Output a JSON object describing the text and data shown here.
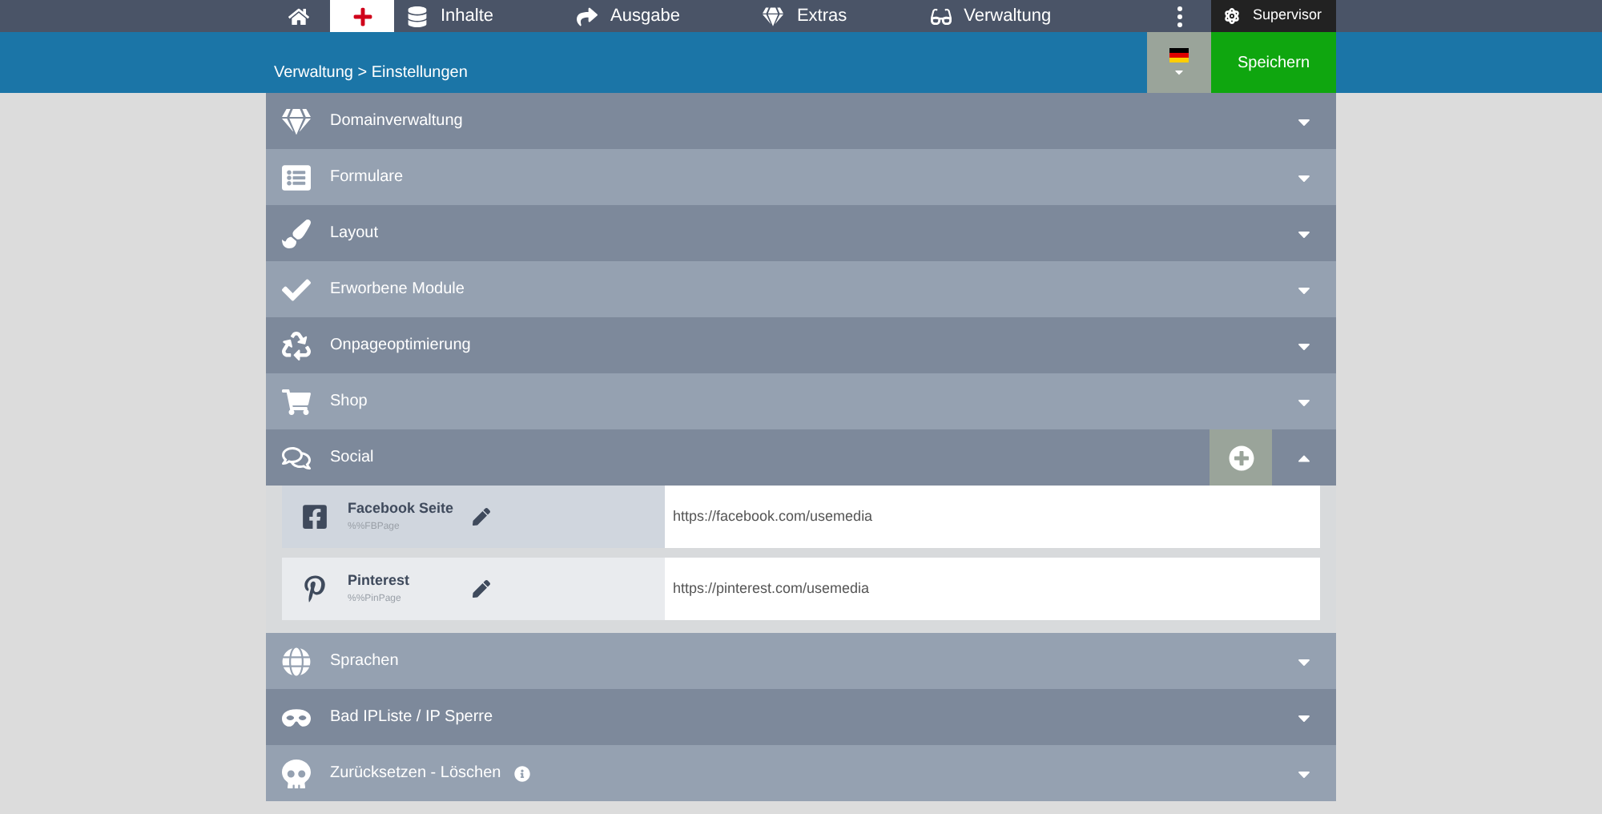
{
  "nav": {
    "items": [
      {
        "kind": "home",
        "selected": false
      },
      {
        "kind": "cross",
        "selected": true
      },
      {
        "kind": "content",
        "label": "Inhalte",
        "selected": false
      },
      {
        "kind": "output",
        "label": "Ausgabe",
        "selected": false
      },
      {
        "kind": "extras",
        "label": "Extras",
        "selected": false
      },
      {
        "kind": "admin",
        "label": "Verwaltung",
        "selected": false
      }
    ],
    "user": "Supervisor"
  },
  "breadcrumb": "Verwaltung > Einstellungen",
  "save_button": "Speichern",
  "sections": [
    {
      "kind": "domain",
      "label": "Domainverwaltung",
      "expanded": false
    },
    {
      "kind": "forms",
      "label": "Formulare",
      "expanded": false
    },
    {
      "kind": "layout",
      "label": "Layout",
      "expanded": false
    },
    {
      "kind": "modules",
      "label": "Erworbene Module",
      "expanded": false
    },
    {
      "kind": "onpage",
      "label": "Onpageoptimierung",
      "expanded": false
    },
    {
      "kind": "shop",
      "label": "Shop",
      "expanded": false
    },
    {
      "kind": "social",
      "label": "Social",
      "expanded": true,
      "entries": [
        {
          "kind": "facebook",
          "name": "Facebook Seite",
          "variable": "%%FBPage",
          "value": "https://facebook.com/usemedia"
        },
        {
          "kind": "pinterest",
          "name": "Pinterest",
          "variable": "%%PinPage",
          "value": "https://pinterest.com/usemedia"
        }
      ]
    },
    {
      "kind": "languages",
      "label": "Sprachen",
      "expanded": false
    },
    {
      "kind": "ipblock",
      "label": "Bad IPListe / IP Sperre",
      "expanded": false
    },
    {
      "kind": "reset",
      "label": "Zurücksetzen - Löschen",
      "expanded": false,
      "info": true
    }
  ]
}
